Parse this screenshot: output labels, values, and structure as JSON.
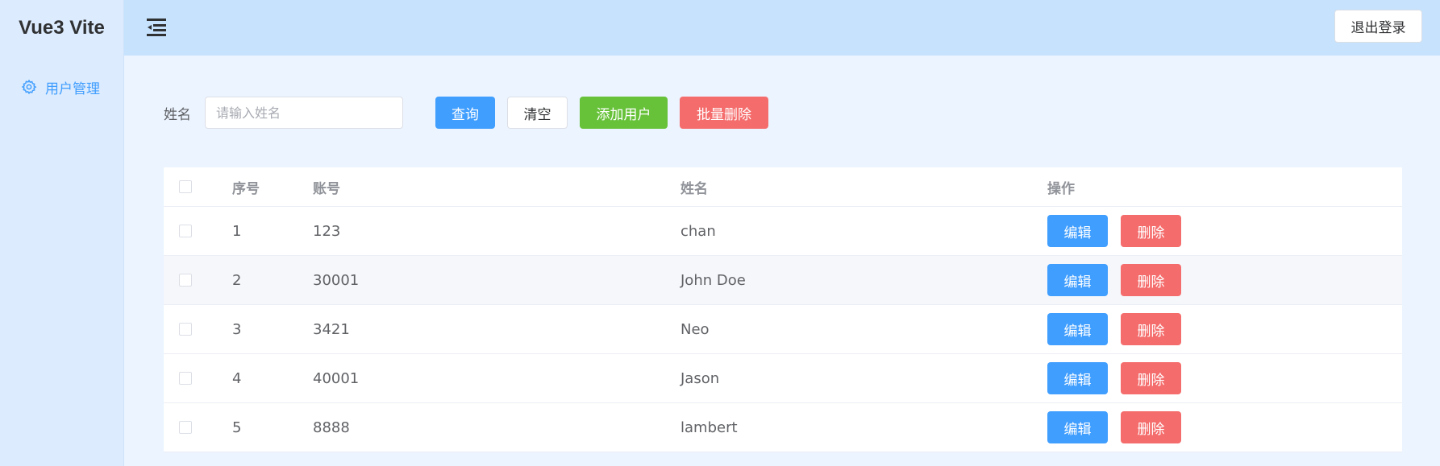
{
  "sidebar": {
    "brand": "Vue3 Vite",
    "items": [
      {
        "label": "用户管理",
        "icon": "gear-icon",
        "active": true
      }
    ]
  },
  "header": {
    "collapse_icon": "menu-fold-icon",
    "logout_label": "退出登录"
  },
  "search": {
    "label": "姓名",
    "placeholder": "请输入姓名",
    "value": "",
    "query_label": "查询",
    "clear_label": "清空",
    "add_label": "添加用户",
    "batch_delete_label": "批量删除"
  },
  "table": {
    "columns": {
      "index": "序号",
      "account": "账号",
      "name": "姓名",
      "ops": "操作"
    },
    "rows": [
      {
        "index": "1",
        "account": "123",
        "name": "chan"
      },
      {
        "index": "2",
        "account": "30001",
        "name": "John Doe"
      },
      {
        "index": "3",
        "account": "3421",
        "name": "Neo"
      },
      {
        "index": "4",
        "account": "40001",
        "name": "Jason"
      },
      {
        "index": "5",
        "account": "8888",
        "name": "lambert"
      }
    ],
    "edit_label": "编辑",
    "delete_label": "删除"
  },
  "colors": {
    "primary": "#409eff",
    "success": "#67c23a",
    "danger": "#f56c6c",
    "header_bg": "#c6e2fd",
    "sidebar_bg": "#dcebfd",
    "page_bg": "#ecf4ff"
  }
}
